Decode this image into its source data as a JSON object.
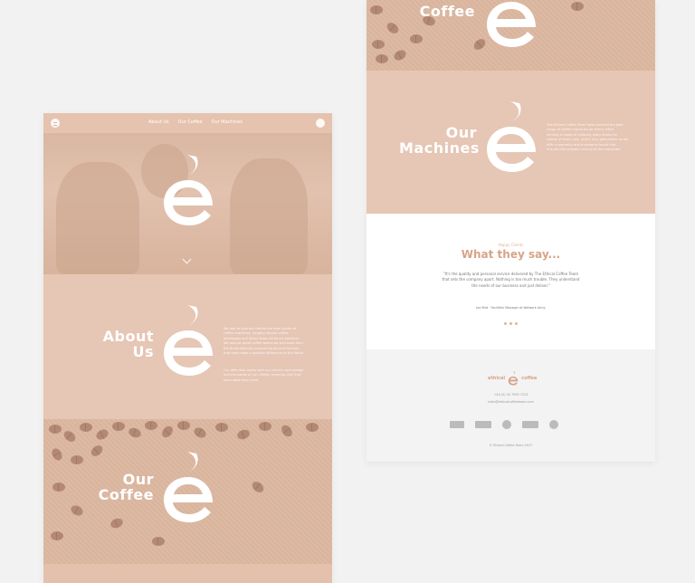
{
  "left": {
    "nav": {
      "links": [
        "About Us",
        "Our Coffee",
        "Our Machines"
      ]
    },
    "about": {
      "title_line1": "About",
      "title_line2": "Us",
      "paragraph1": "We aim to give our clients the best choice of coffee machines, ranging natural coffee beverages and latest state-of-the-art products. We also do great coffee beans we purchase from the finest ethically sourced farms and farmers that help make a positive difference to the World.",
      "paragraph2": "Our offer also works with our client's care pledge and the needs of our clients, ensuring that they have what they need."
    },
    "coffee": {
      "title_line1": "Our",
      "title_line2": "Coffee"
    }
  },
  "right": {
    "coffee_top": {
      "title": "Coffee"
    },
    "machines": {
      "title_line1": "Our",
      "title_line2": "Machines",
      "paragraph": "The Ethical Coffee Team have sourced the best range of coffee machines for every office. Serving a range of uniquely tasty drinks for clients of every size. And it only gets better as we offer a warranty and a personal touch that ensures the smooth running of the machines."
    },
    "testimonial": {
      "kicker": "Happy Clients",
      "title": "What they say...",
      "quote": "\"It's the quality and personal service delivered by The Ethical Coffee Team that sets the company apart. Nothing is too much trouble. They understand the needs of our business and just deliver.\"",
      "author": "Joe Bird · Facilities Manager at Network Army"
    },
    "footer": {
      "brand_left": "ethical",
      "brand_right": "coffee",
      "phone": "+44 (0) 20 7993 7223",
      "email": "hello@ethicalcoffeeteam.com",
      "copyright": "© Ethical Coffee Team 2017"
    }
  },
  "colors": {
    "primary": "#e6c6b4",
    "accent": "#d7a488",
    "background": "#f2f2f2"
  }
}
